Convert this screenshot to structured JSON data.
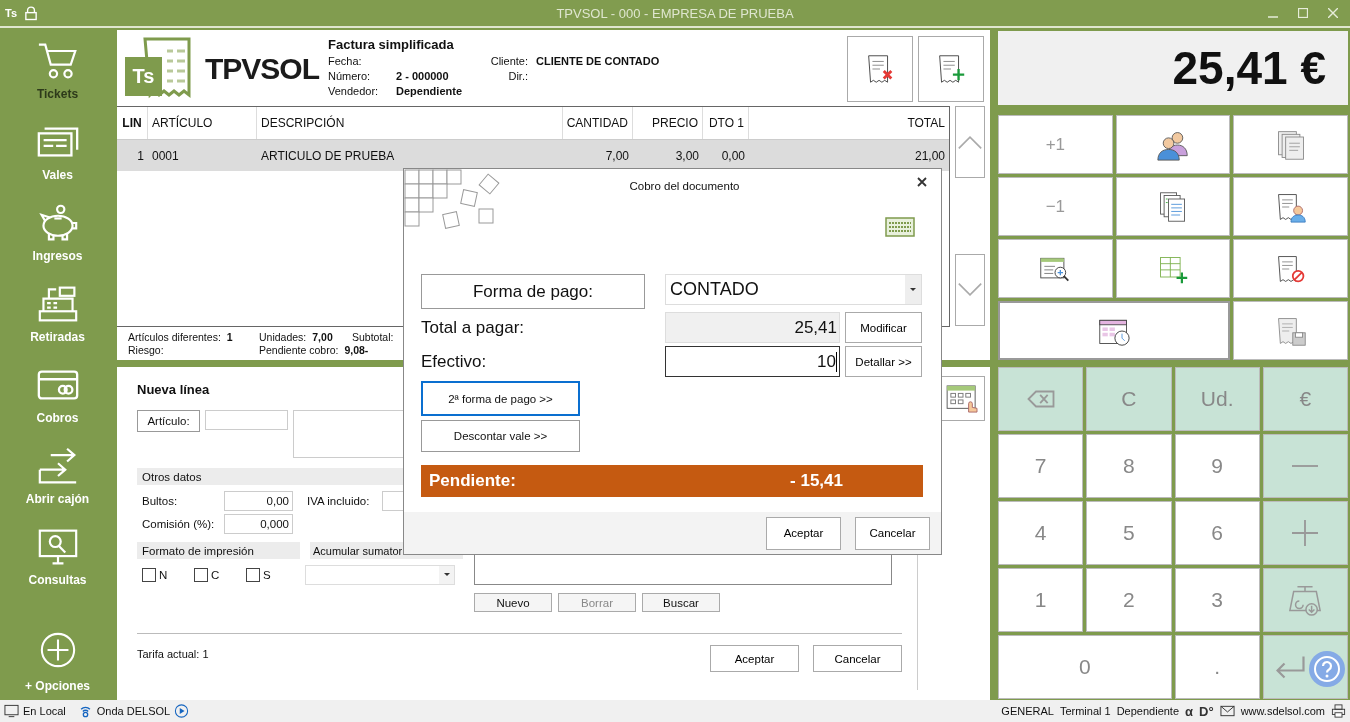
{
  "title_bar": {
    "badge": "Ts",
    "title": "TPVSOL - 000 - EMPRESA DE PRUEBA"
  },
  "sidebar": {
    "items": [
      {
        "label": "Tickets",
        "selected": true
      },
      {
        "label": "Vales",
        "selected": false
      },
      {
        "label": "Ingresos",
        "selected": false
      },
      {
        "label": "Retiradas",
        "selected": false
      },
      {
        "label": "Cobros",
        "selected": false
      },
      {
        "label": "Abrir cajón",
        "selected": false
      },
      {
        "label": "Consultas",
        "selected": false
      }
    ],
    "options_label": "+ Opciones"
  },
  "document": {
    "logo_badge": "Ts",
    "logo_name": "TPVSOL",
    "type": "Factura simplificada",
    "info": [
      {
        "label": "Fecha:"
      },
      {
        "label": "Número:",
        "value": "2 - 000000"
      },
      {
        "label": "Vendedor:",
        "value": "Dependiente"
      }
    ],
    "client": [
      {
        "label": "Cliente:",
        "value": "CLIENTE DE CONTADO"
      },
      {
        "label": "Dir.:"
      }
    ]
  },
  "table": {
    "columns": [
      "LIN",
      "ARTÍCULO",
      "DESCRIPCIÓN",
      "CANTIDAD",
      "PRECIO",
      "DTO 1",
      "TOTAL"
    ],
    "rows": [
      {
        "selected": true,
        "cells": [
          "1",
          "0001",
          "ARTICULO DE PRUEBA",
          "7,00",
          "3,00",
          "0,00",
          "21,00"
        ]
      }
    ]
  },
  "summary": [
    [
      {
        "label": "Artículos diferentes:",
        "value": "1"
      },
      {
        "label": "Riesgo:"
      }
    ],
    [
      {
        "label": "Unidades:",
        "value": "7,00"
      },
      {
        "label": "Pendiente cobro:",
        "value": "9,08-"
      }
    ],
    [
      {
        "label": "Subtotal:"
      }
    ]
  ],
  "total_display": "25,41 €",
  "function_keys": [
    "+1",
    "−1"
  ],
  "numpad": [
    {
      "kind": "icon"
    },
    {
      "kind": "operation",
      "label": "C"
    },
    {
      "kind": "operation",
      "label": "Ud."
    },
    {
      "kind": "operation",
      "label": "€"
    },
    {
      "kind": "digit",
      "label": "7"
    },
    {
      "kind": "digit",
      "label": "8"
    },
    {
      "kind": "digit",
      "label": "9"
    },
    {
      "kind": "icon"
    },
    {
      "kind": "digit",
      "label": "4"
    },
    {
      "kind": "digit",
      "label": "5"
    },
    {
      "kind": "digit",
      "label": "6"
    },
    {
      "kind": "icon"
    },
    {
      "kind": "digit",
      "label": "1"
    },
    {
      "kind": "digit",
      "label": "2"
    },
    {
      "kind": "digit",
      "label": "3"
    },
    {
      "kind": "icon"
    },
    {
      "kind": "digit",
      "label": "0",
      "wide": true
    },
    {
      "kind": "digit",
      "label": "."
    },
    {
      "kind": "icon"
    }
  ],
  "new_line": {
    "title": "Nueva línea",
    "article_label": "Artículo:",
    "other_section": "Otros datos",
    "bultos_label": "Bultos:",
    "bultos": "0,00",
    "commission_label": "Comisión (%):",
    "commission": "0,000",
    "iva_label": "IVA incluido:",
    "print_section": "Formato de impresión",
    "accumulate_section": "Acumular sumator",
    "print_formats": [
      {
        "label": "N",
        "checked": false
      },
      {
        "label": "C",
        "checked": false
      },
      {
        "label": "S",
        "checked": false
      }
    ],
    "buttons": [
      {
        "label": "Nuevo",
        "disabled": false
      },
      {
        "label": "Borrar",
        "disabled": true
      },
      {
        "label": "Buscar",
        "disabled": false
      }
    ],
    "tariff": "Tarifa actual: 1",
    "footer_buttons": [
      "Aceptar",
      "Cancelar"
    ]
  },
  "dialog": {
    "title": "Cobro del documento",
    "payment_method_label": "Forma de pago:",
    "payment_method": "CONTADO",
    "total_label": "Total a pagar:",
    "total": "25,41",
    "modify_button": "Modificar",
    "cash_label": "Efectivo:",
    "cash": "10",
    "detail_button": "Detallar >>",
    "side_buttons": [
      {
        "label": "2ª forma de pago >>",
        "focused": true
      },
      {
        "label": "Descontar vale >>",
        "focused": false
      }
    ],
    "pending_label": "Pendiente:",
    "pending": "- 15,41",
    "buttons": [
      "Aceptar",
      "Cancelar"
    ]
  },
  "status_bar": {
    "left": [
      "En Local",
      "Onda DELSOL"
    ],
    "right": [
      "GENERAL",
      "Terminal 1",
      "Dependiente"
    ],
    "marks": [
      "α",
      "D°"
    ],
    "website": "www.sdelsol.com"
  }
}
